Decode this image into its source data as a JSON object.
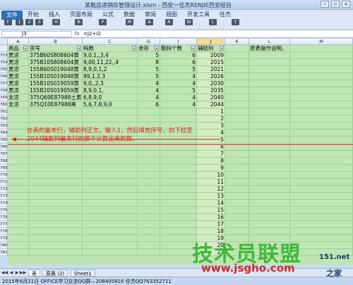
{
  "window": {
    "title": "某鞋店进销存管理设计.xlsm - 西安一任杰RENJIE西安经验",
    "controls": [
      "−",
      "▫",
      "×"
    ]
  },
  "ribbon": {
    "file_tab": "文件",
    "tabs": [
      "开始",
      "插入",
      "页面布局",
      "公式",
      "数据",
      "审阅",
      "视图",
      "开发工具",
      "任杰"
    ],
    "keytips": [
      "F",
      "1",
      "2",
      "3",
      "H",
      "N",
      "P",
      "M",
      "A",
      "R",
      "W",
      "L",
      "Y"
    ]
  },
  "formula_bar": {
    "name_box": "J3",
    "fx": "fx",
    "formula": "=J2+I2"
  },
  "columns": [
    "A",
    "B",
    "C",
    "G",
    "I",
    "J",
    "K",
    "L",
    "M"
  ],
  "header_row": {
    "row_num": "2",
    "cells": [
      "商品",
      "货号",
      "码数",
      "余存",
      "鞋码个数",
      "辅助列",
      "",
      "原表操作说明。",
      ""
    ]
  },
  "rows": [
    {
      "num": "753",
      "cells": [
        "男凉",
        "375B60S808604黄",
        "9,0,1,,3,4",
        "5",
        "6",
        "2009",
        "",
        "",
        ""
      ]
    },
    {
      "num": "754",
      "cells": [
        "男凉",
        "375B10S808604黄",
        "9,00,11,22,,4",
        "8",
        "6",
        "2015",
        "",
        "",
        ""
      ]
    },
    {
      "num": "755",
      "cells": [
        "男凉",
        "155B60S019048黄",
        "8,9,0,1,2",
        "5",
        "5",
        "2021",
        "",
        "",
        ""
      ]
    },
    {
      "num": "756",
      "cells": [
        "男凉",
        "155B10S019048黄",
        "99,1,2,3",
        "5",
        "4",
        "2026",
        "",
        "",
        ""
      ]
    },
    {
      "num": "757",
      "cells": [
        "男凉",
        "155B10S019059黄",
        "9,0,,2,3",
        "4",
        "4",
        "2030",
        "",
        "",
        ""
      ]
    },
    {
      "num": "758",
      "cells": [
        "男凉",
        "155B20S019059黄",
        "8,9,0,1,",
        "4",
        "5",
        "2035",
        "",
        "",
        ""
      ]
    },
    {
      "num": "759",
      "cells": [
        "女凉",
        "375Q69E87988土黄",
        "6,8,9,0",
        "4",
        "4",
        "2040",
        "",
        "",
        ""
      ]
    },
    {
      "num": "760",
      "cells": [
        "女凉",
        "375Q10E87988黑",
        "5,6,7,8,9,0",
        "6",
        "4",
        "2044",
        "",
        "",
        ""
      ]
    },
    {
      "num": "761",
      "cells": [
        "",
        "",
        "",
        "",
        "",
        "1",
        "",
        "",
        ""
      ]
    },
    {
      "num": "762",
      "cells": [
        "",
        "",
        "",
        "",
        "",
        "2",
        "",
        "",
        ""
      ]
    },
    {
      "num": "763",
      "cells": [
        "",
        "",
        "",
        "",
        "",
        "3",
        "",
        "",
        ""
      ]
    },
    {
      "num": "764",
      "cells": [
        "",
        "",
        "",
        "",
        "",
        "4",
        "",
        "",
        ""
      ]
    },
    {
      "num": "765",
      "cells": [
        "",
        "",
        "",
        "",
        "",
        "5",
        "",
        "",
        ""
      ]
    },
    {
      "num": "766",
      "cells": [
        "",
        "",
        "",
        "",
        "",
        "6",
        "",
        "",
        ""
      ]
    },
    {
      "num": "767",
      "cells": [
        "",
        "",
        "",
        "",
        "",
        "7",
        "",
        "",
        ""
      ]
    },
    {
      "num": "768",
      "cells": [
        "",
        "",
        "",
        "",
        "",
        "8",
        "",
        "",
        ""
      ]
    },
    {
      "num": "769",
      "cells": [
        "",
        "",
        "",
        "",
        "",
        "9",
        "",
        "",
        ""
      ]
    },
    {
      "num": "770",
      "cells": [
        "",
        "",
        "",
        "",
        "",
        "10",
        "",
        "",
        ""
      ]
    },
    {
      "num": "771",
      "cells": [
        "",
        "",
        "",
        "",
        "",
        "11",
        "",
        "",
        ""
      ]
    },
    {
      "num": "772",
      "cells": [
        "",
        "",
        "",
        "",
        "",
        "12",
        "",
        "",
        ""
      ]
    },
    {
      "num": "773",
      "cells": [
        "",
        "",
        "",
        "",
        "",
        "13",
        "",
        "",
        ""
      ]
    },
    {
      "num": "774",
      "cells": [
        "",
        "",
        "",
        "",
        "",
        "14",
        "",
        "",
        ""
      ]
    },
    {
      "num": "775",
      "cells": [
        "",
        "",
        "",
        "",
        "",
        "15",
        "",
        "",
        ""
      ]
    },
    {
      "num": "776",
      "cells": [
        "",
        "",
        "",
        "",
        "",
        "16",
        "",
        "",
        ""
      ]
    },
    {
      "num": "777",
      "cells": [
        "",
        "",
        "",
        "",
        "",
        "17",
        "",
        "",
        ""
      ]
    },
    {
      "num": "778",
      "cells": [
        "",
        "",
        "",
        "",
        "",
        "18",
        "",
        "",
        ""
      ]
    },
    {
      "num": "779",
      "cells": [
        "",
        "",
        "",
        "",
        "",
        "19",
        "",
        "",
        ""
      ]
    },
    {
      "num": "780",
      "cells": [
        "",
        "",
        "",
        "",
        "",
        "20",
        "",
        "",
        ""
      ]
    },
    {
      "num": "781",
      "cells": [
        "",
        "",
        "",
        "",
        "",
        "21",
        "",
        "",
        ""
      ]
    }
  ],
  "annotation": "在表的最末行，辅助列正文，输入1，然后填充序号，向下拉至2044辅助列最末行的那个计算出来的数。",
  "sheet_tabs": [
    "表",
    "原表 (2)",
    "Sheet1"
  ],
  "sheet_nav": [
    "◀◀",
    "◀",
    "▶",
    "▶▶"
  ],
  "status_bar": "2015年6月21日   OFFICE学习交流QQ群—208405816  任杰QQ763352711",
  "watermark": {
    "main": "技术员联盟",
    "url": "www.jsgho.com",
    "small": "151.net",
    "home": "之家"
  },
  "colors": {
    "grid_fill": "#bfe5b5",
    "annotation": "#e02010",
    "selected_cell": "#fbe9a4",
    "file_tab": "#2a6fbd",
    "watermark_green": "#40b83a",
    "watermark_red": "#d02a2a"
  }
}
